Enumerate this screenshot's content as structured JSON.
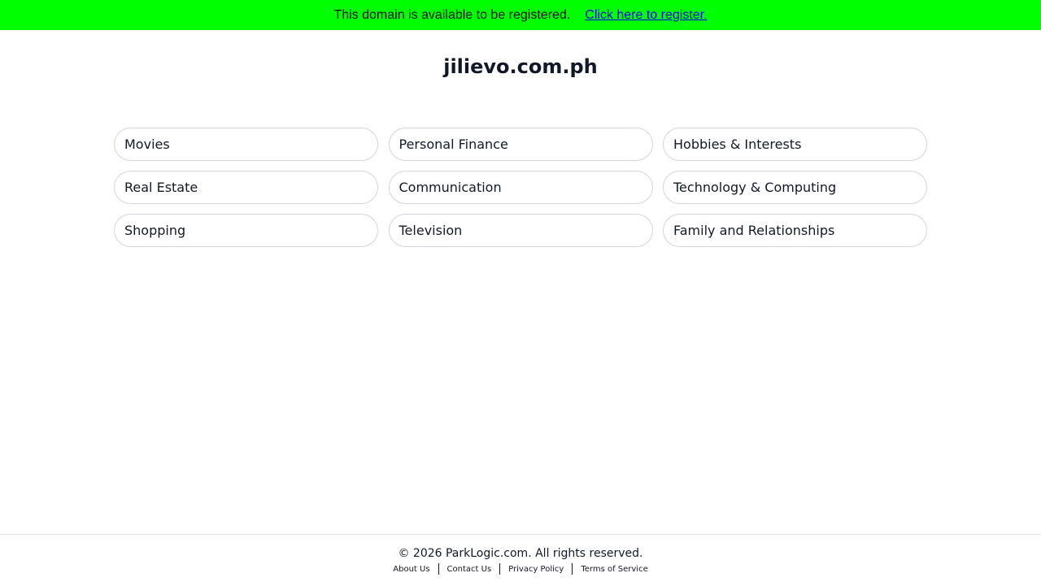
{
  "banner": {
    "message": "This domain is available to be registered.",
    "link_label": "Click here to register.",
    "background": "#00ff00"
  },
  "domain": "jilievo.com.ph",
  "categories": [
    "Movies",
    "Personal Finance",
    "Hobbies & Interests",
    "Real Estate",
    "Communication",
    "Technology & Computing",
    "Shopping",
    "Television",
    "Family and Relationships"
  ],
  "footer": {
    "copyright": "© 2026 ParkLogic.com. All rights reserved.",
    "links": [
      "About Us",
      "Contact Us",
      "Privacy Policy",
      "Terms of Service"
    ]
  }
}
